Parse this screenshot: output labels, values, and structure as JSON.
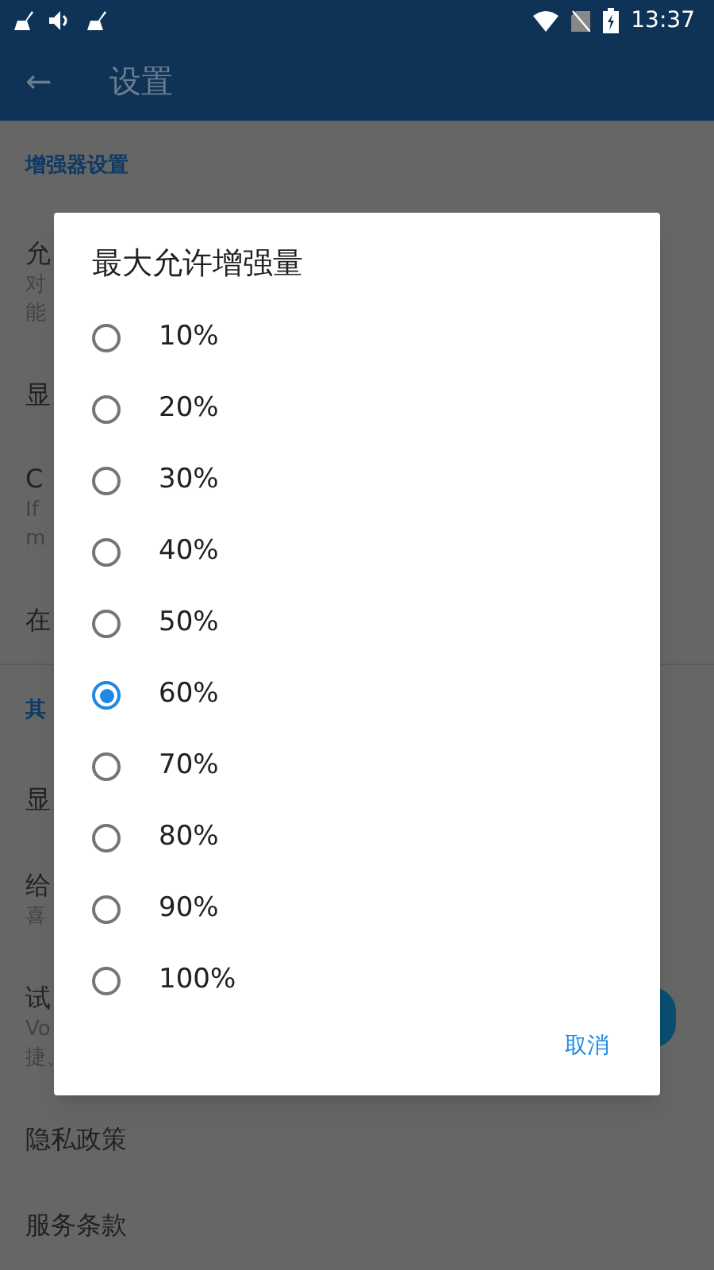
{
  "status_bar": {
    "time": "13:37"
  },
  "app_bar": {
    "back": "←",
    "title": "设置"
  },
  "background_list": [
    {
      "kind": "header",
      "text": "增强器设置"
    },
    {
      "kind": "item",
      "title": "允",
      "lines": [
        "对",
        "能"
      ]
    },
    {
      "kind": "item",
      "title": "显"
    },
    {
      "kind": "item",
      "title": "C",
      "lines": [
        "If",
        "m"
      ]
    },
    {
      "kind": "item",
      "title": "在"
    },
    {
      "kind": "divider"
    },
    {
      "kind": "header",
      "text": "其"
    },
    {
      "kind": "item",
      "title": "显"
    },
    {
      "kind": "item",
      "title": "给",
      "lines": [
        "喜"
      ]
    },
    {
      "kind": "item",
      "title": "试",
      "lines": [
        "Vo",
        "捷、"
      ]
    },
    {
      "kind": "item",
      "title": "隐私政策"
    },
    {
      "kind": "item",
      "title": "服务条款"
    }
  ],
  "dialog": {
    "title": "最大允许增强量",
    "options": [
      {
        "label": "10%",
        "selected": false
      },
      {
        "label": "20%",
        "selected": false
      },
      {
        "label": "30%",
        "selected": false
      },
      {
        "label": "40%",
        "selected": false
      },
      {
        "label": "50%",
        "selected": false
      },
      {
        "label": "60%",
        "selected": true
      },
      {
        "label": "70%",
        "selected": false
      },
      {
        "label": "80%",
        "selected": false
      },
      {
        "label": "90%",
        "selected": false
      },
      {
        "label": "100%",
        "selected": false
      }
    ],
    "cancel": "取消"
  }
}
